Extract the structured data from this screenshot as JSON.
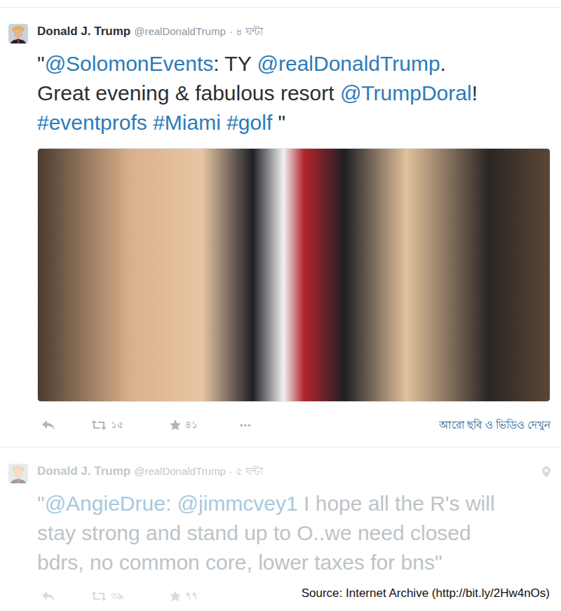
{
  "tweets": [
    {
      "name": "Donald J. Trump",
      "handle": "@realDonaldTrump",
      "time": "· ৪ ঘন্টা",
      "faded": false,
      "has_photo": true,
      "lines": [
        [
          {
            "kind": "text",
            "text": "\""
          },
          {
            "kind": "link",
            "text": "@SolomonEvents"
          },
          {
            "kind": "text",
            "text": ": TY "
          },
          {
            "kind": "link",
            "text": "@realDonaldTrump"
          },
          {
            "kind": "text",
            "text": "."
          }
        ],
        [
          {
            "kind": "text",
            "text": "Great evening & fabulous resort "
          },
          {
            "kind": "link",
            "text": "@TrumpDoral"
          },
          {
            "kind": "text",
            "text": "!"
          }
        ],
        [
          {
            "kind": "link",
            "text": "#eventprofs"
          },
          {
            "kind": "text",
            "text": " "
          },
          {
            "kind": "link",
            "text": "#Miami"
          },
          {
            "kind": "text",
            "text": " "
          },
          {
            "kind": "link",
            "text": "#golf"
          },
          {
            "kind": "text",
            "text": " \""
          }
        ]
      ],
      "retweets": "১৫",
      "favorites": "৪১",
      "more": "•••",
      "media_link": "আরো ছবি ও ভিডিও দেখুন"
    },
    {
      "name": "Donald J. Trump",
      "handle": "@realDonaldTrump",
      "time": "· ৫ ঘন্টা",
      "faded": true,
      "has_location": true,
      "lines": [
        [
          {
            "kind": "text",
            "text": "\""
          },
          {
            "kind": "link",
            "text": "@AngieDrue"
          },
          {
            "kind": "text",
            "text": ": "
          },
          {
            "kind": "link",
            "text": "@jimmcvey1"
          },
          {
            "kind": "text",
            "text": " I hope all the R's will"
          }
        ],
        [
          {
            "kind": "text",
            "text": "stay strong and stand up to O..we need closed"
          }
        ],
        [
          {
            "kind": "text",
            "text": "bdrs, no common core, lower taxes for bns\""
          }
        ]
      ],
      "retweets": "৩৯",
      "favorites": "৭৭"
    }
  ],
  "source": "Source: Internet Archive (http://bit.ly/2Hw4nOs)"
}
